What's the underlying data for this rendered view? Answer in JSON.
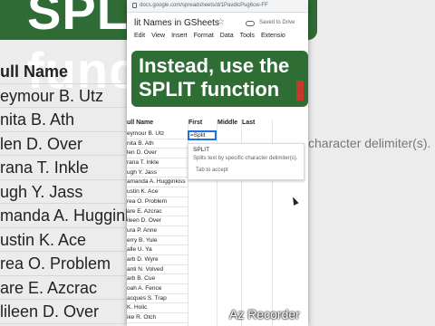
{
  "background": {
    "banner_text": "SPLIT function",
    "right_text": "character delimiter(s).",
    "rows": [
      "ull Name",
      "eymour B. Utz",
      "nita B. Ath",
      "len D. Over",
      "rana T. Inkle",
      "ugh Y. Jass",
      "manda A. Hugginki",
      "ustin K. Ace",
      "rea O. Problem",
      "are E. Azcrac",
      "lileen D. Over"
    ]
  },
  "browser": {
    "url": "docs.google.com/spreadsheets/d/1PavdicPug6cw-FF"
  },
  "doc": {
    "title": "lit Names in GSheets",
    "star": "☆",
    "saved": "Saved to Drive"
  },
  "menu": [
    "Edit",
    "View",
    "Insert",
    "Format",
    "Data",
    "Tools",
    "Extensio"
  ],
  "overlay": {
    "line1": "Instead, use the",
    "line2": "SPLIT function"
  },
  "sheet": {
    "headers": {
      "a": "ull Name",
      "b": "First",
      "c": "Middle",
      "d": "Last"
    },
    "active_cell_value": "=Split",
    "rows": [
      "eymour B. Utz",
      "nita B. Ath",
      "len D. Over",
      "rana T. Inkle",
      "ugh Y. Jass",
      "amanda A. Hugginkiss",
      "ustin K. Ace",
      "rea O. Problem",
      "are E. Azcrac",
      "ileen D. Over",
      "ura P. Anne",
      "erry B. Yule",
      "alle U. Ya",
      "arb D. Wyre",
      "anti N. Volved",
      "arb B. Cue",
      "oah A. Fence",
      "acques S. Trap",
      "K. Holic",
      "ike R. Otch"
    ]
  },
  "autocomplete": {
    "name": "SPLIT",
    "description": "Splits text by specific character delimiter(s).",
    "hint": "Tab  to accept"
  },
  "watermark": "Az Recorder"
}
